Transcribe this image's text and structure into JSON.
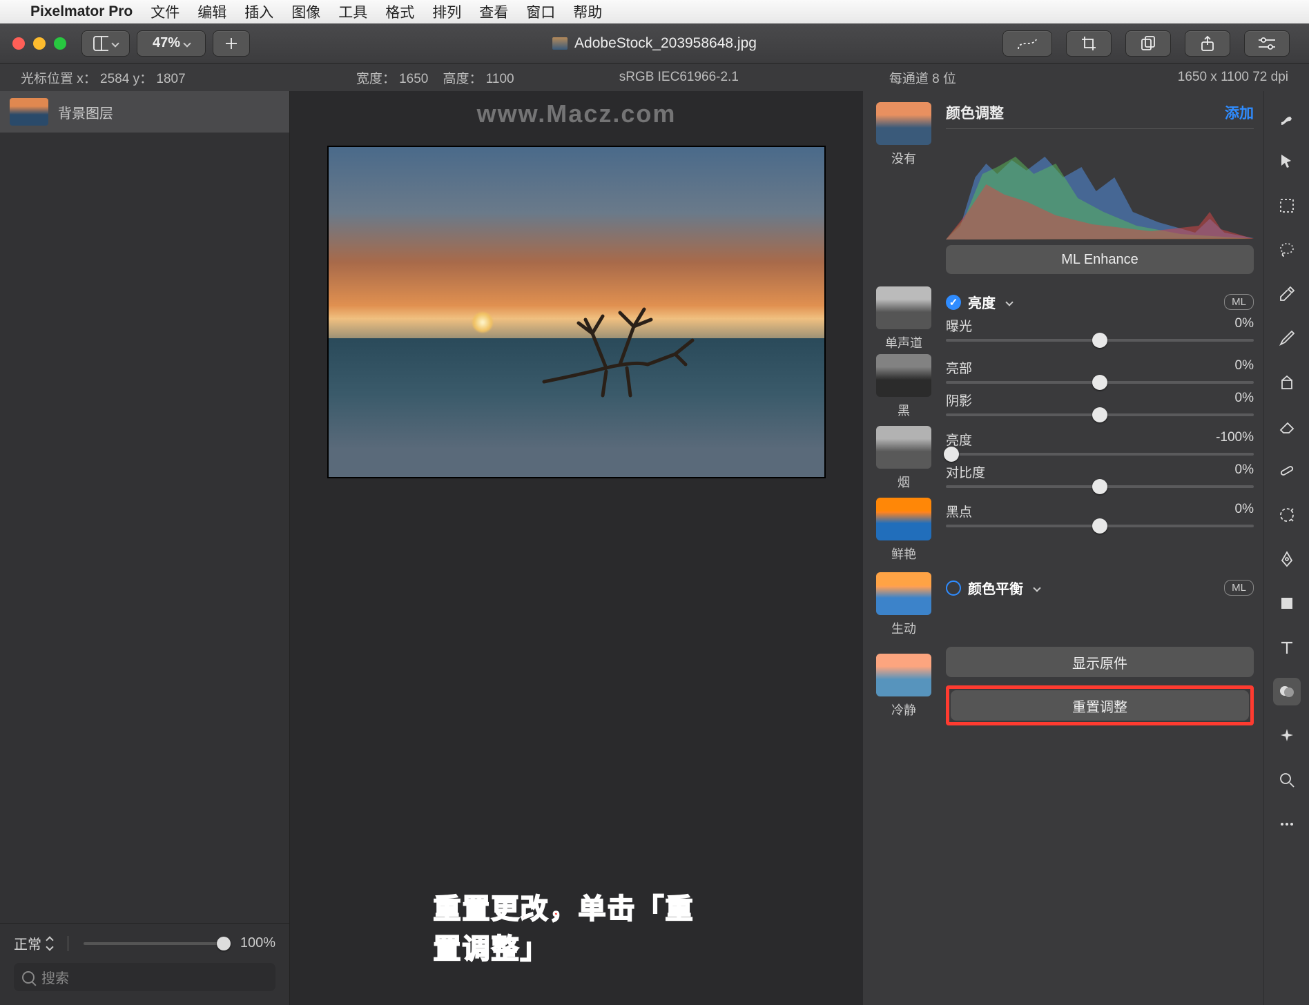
{
  "menubar": {
    "app": "Pixelmator Pro",
    "items": [
      "文件",
      "编辑",
      "插入",
      "图像",
      "工具",
      "格式",
      "排列",
      "查看",
      "窗口",
      "帮助"
    ]
  },
  "toolbar": {
    "zoom": "47%",
    "filename": "AdobeStock_203958648.jpg"
  },
  "infobar": {
    "cursor": "光标位置 x： 2584     y： 1807",
    "width": "宽度： 1650",
    "height": "高度： 1100",
    "colorspace": "sRGB IEC61966-2.1",
    "depth": "每通道 8 位",
    "dims": "1650 x 1100 72 dpi"
  },
  "layers": {
    "background": "背景图层",
    "blend_mode": "正常",
    "opacity": "100%",
    "search_placeholder": "搜索"
  },
  "adjust": {
    "title": "颜色调整",
    "add": "添加",
    "ml_enhance": "ML Enhance",
    "brightness_section": "亮度",
    "color_balance_section": "颜色平衡",
    "ml_pill": "ML",
    "sliders": {
      "exposure": {
        "label": "曝光",
        "value": "0%",
        "pos": 50
      },
      "highlights": {
        "label": "亮部",
        "value": "0%",
        "pos": 50
      },
      "shadows": {
        "label": "阴影",
        "value": "0%",
        "pos": 50
      },
      "brightness": {
        "label": "亮度",
        "value": "-100%",
        "pos": 0
      },
      "contrast": {
        "label": "对比度",
        "value": "0%",
        "pos": 50
      },
      "blackpoint": {
        "label": "黑点",
        "value": "0%",
        "pos": 50
      }
    },
    "show_original": "显示原件",
    "reset": "重置调整",
    "presets": {
      "none": "没有",
      "mono": "单声道",
      "black": "黑",
      "smoke": "烟",
      "vivid": "鲜艳",
      "lively": "生动",
      "cool": "冷静"
    }
  },
  "annotation": "重置更改，单击「重置调整」",
  "watermark": "www.Macz.com"
}
